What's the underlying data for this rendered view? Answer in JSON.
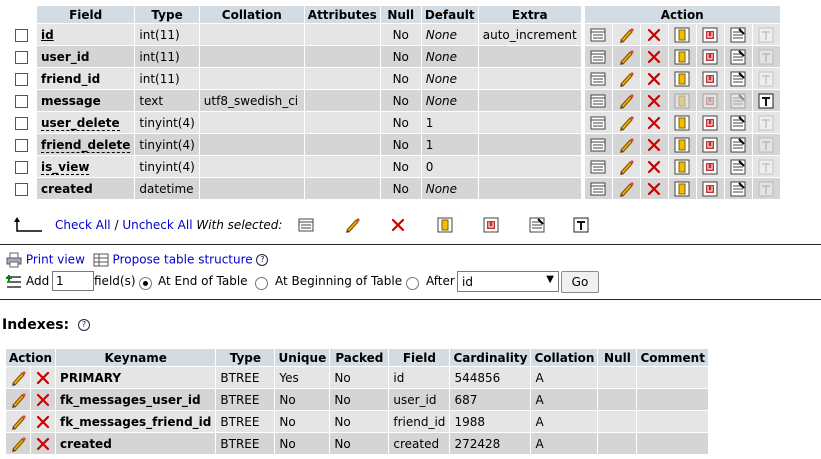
{
  "structure": {
    "columns": [
      "Field",
      "Type",
      "Collation",
      "Attributes",
      "Null",
      "Default",
      "Extra"
    ],
    "action_header": "Action",
    "rows": [
      {
        "field": "id",
        "type": "int(11)",
        "collation": "",
        "attributes": "",
        "null": "No",
        "default": "None",
        "extra": "auto_increment"
      },
      {
        "field": "user_id",
        "type": "int(11)",
        "collation": "",
        "attributes": "",
        "null": "No",
        "default": "None",
        "extra": ""
      },
      {
        "field": "friend_id",
        "type": "int(11)",
        "collation": "",
        "attributes": "",
        "null": "No",
        "default": "None",
        "extra": ""
      },
      {
        "field": "message",
        "type": "text",
        "collation": "utf8_swedish_ci",
        "attributes": "",
        "null": "No",
        "default": "None",
        "extra": ""
      },
      {
        "field": "user_delete",
        "type": "tinyint(4)",
        "collation": "",
        "attributes": "",
        "null": "No",
        "default": "1",
        "extra": ""
      },
      {
        "field": "friend_delete",
        "type": "tinyint(4)",
        "collation": "",
        "attributes": "",
        "null": "No",
        "default": "1",
        "extra": ""
      },
      {
        "field": "is_view",
        "type": "tinyint(4)",
        "collation": "",
        "attributes": "",
        "null": "No",
        "default": "0",
        "extra": ""
      },
      {
        "field": "created",
        "type": "datetime",
        "collation": "",
        "attributes": "",
        "null": "No",
        "default": "None",
        "extra": ""
      }
    ],
    "check_all": "Check All",
    "separator": "/",
    "uncheck_all": "Uncheck All",
    "with_selected": "With selected:"
  },
  "actions": {
    "print_view": "Print view",
    "propose": "Propose table structure",
    "add": "Add",
    "add_count": "1",
    "fields": "field(s)",
    "at_end": "At End of Table",
    "at_beginning": "At Beginning of Table",
    "after": "After",
    "after_value": "id",
    "go": "Go"
  },
  "indexes": {
    "title": "Indexes:",
    "columns": [
      "Action",
      "Keyname",
      "Type",
      "Unique",
      "Packed",
      "Field",
      "Cardinality",
      "Collation",
      "Null",
      "Comment"
    ],
    "rows": [
      {
        "keyname": "PRIMARY",
        "type": "BTREE",
        "unique": "Yes",
        "packed": "No",
        "field": "id",
        "cardinality": "544856",
        "collation": "A",
        "null": "",
        "comment": ""
      },
      {
        "keyname": "fk_messages_user_id",
        "type": "BTREE",
        "unique": "No",
        "packed": "No",
        "field": "user_id",
        "cardinality": "687",
        "collation": "A",
        "null": "",
        "comment": ""
      },
      {
        "keyname": "fk_messages_friend_id",
        "type": "BTREE",
        "unique": "No",
        "packed": "No",
        "field": "friend_id",
        "cardinality": "1988",
        "collation": "A",
        "null": "",
        "comment": ""
      },
      {
        "keyname": "created",
        "type": "BTREE",
        "unique": "No",
        "packed": "No",
        "field": "created",
        "cardinality": "272428",
        "collation": "A",
        "null": "",
        "comment": ""
      }
    ]
  },
  "colors": {
    "header": "#d3dce3",
    "row_odd": "#e5e5e5",
    "row_even": "#d5d5d5",
    "link": "#0000cc",
    "drop": "#cc0000"
  }
}
